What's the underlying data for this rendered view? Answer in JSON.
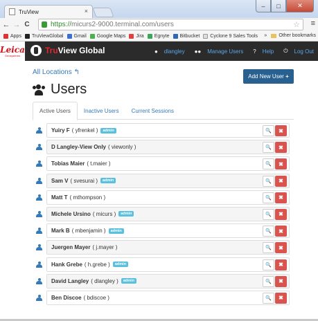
{
  "browser": {
    "tab_title": "TruView",
    "tab_close": "×",
    "window_buttons": {
      "minimize": "–",
      "maximize": "□",
      "close": "✕"
    },
    "nav": {
      "back": "←",
      "forward": "→",
      "reload": "C"
    },
    "url_scheme": "https://",
    "url_rest": "micurs2-9000.terminal.com/users",
    "star": "☆",
    "menu": "≡",
    "bookmarks": [
      {
        "label": "Apps",
        "color": "#d33"
      },
      {
        "label": "TruViewGlobal",
        "color": "#222"
      },
      {
        "label": "Gmail",
        "color": "#3b6fd1"
      },
      {
        "label": "Google Maps",
        "color": "#4caf50"
      },
      {
        "label": "Jira",
        "color": "#e04040"
      },
      {
        "label": "Egnyte",
        "color": "#3ba55c"
      },
      {
        "label": "Bitbucket",
        "color": "#2f68b5"
      },
      {
        "label": "Cyclone 9 Sales Tools",
        "color": "#cccccc"
      }
    ],
    "bookmarks_overflow": "»",
    "other_bookmarks": "Other bookmarks"
  },
  "appbar": {
    "leica_mark": "Leica",
    "leica_sub": "Geosystems",
    "brand_tru": "Tru",
    "brand_rest": "View Global",
    "user": "dlangley",
    "manage_users": "Manage Users",
    "help": "Help",
    "logout": "Log Out"
  },
  "page": {
    "all_locations": "All Locations",
    "all_locations_icon": "↰",
    "add_user_label": "Add New User",
    "add_user_icon": "+",
    "title": "Users",
    "tabs": [
      "Active Users",
      "Inactive Users",
      "Current Sessions"
    ],
    "active_tab": 0
  },
  "users": [
    {
      "name": "Yuiry F",
      "login": "( yfrenkel )",
      "badge": "admin"
    },
    {
      "name": "D Langley-View Only",
      "login": "( viewonly )",
      "badge": ""
    },
    {
      "name": "Tobias Maier",
      "login": "( t.maier )",
      "badge": ""
    },
    {
      "name": "Sam V",
      "login": "( svesurai )",
      "badge": "admin"
    },
    {
      "name": "Matt T",
      "login": "( mthompson )",
      "badge": ""
    },
    {
      "name": "Michele Ursino",
      "login": "( micurs )",
      "badge": "admin"
    },
    {
      "name": "Mark B",
      "login": "( mbenjamin )",
      "badge": "admin"
    },
    {
      "name": "Juergen Mayer",
      "login": "( j.mayer )",
      "badge": ""
    },
    {
      "name": "Hank Grebe",
      "login": "( h.grebe )",
      "badge": "admin"
    },
    {
      "name": "David Langley",
      "login": "( dlangley )",
      "badge": "admin"
    },
    {
      "name": "Ben Discoe",
      "login": "( bdiscoe )",
      "badge": ""
    }
  ],
  "row_actions": {
    "key": "🔍",
    "delete": "✖"
  },
  "colors": {
    "accent": "#337ab7",
    "danger": "#d9534f",
    "badge": "#5bc0de",
    "appbar": "#2b2b2b",
    "brand_red": "#e3262f",
    "primary_button": "#286090"
  }
}
